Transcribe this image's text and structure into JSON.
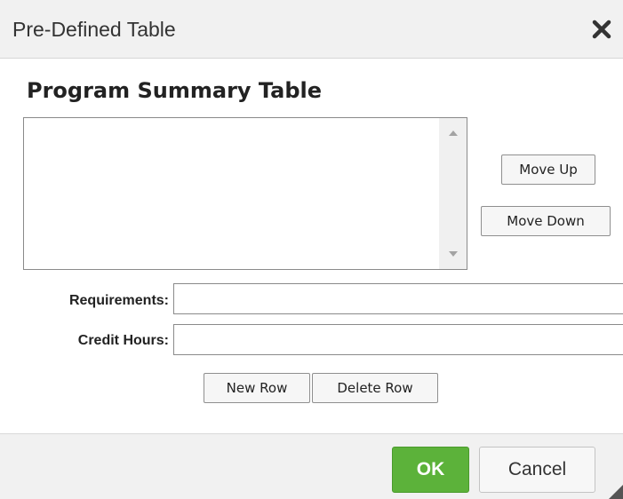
{
  "dialog": {
    "title": "Pre-Defined Table",
    "close_icon": "close-icon"
  },
  "section": {
    "title": "Program Summary Table"
  },
  "listbox": {
    "items": [],
    "scroll_up_icon": "triangle-up-icon",
    "scroll_down_icon": "triangle-down-icon"
  },
  "order_buttons": {
    "move_up": "Move Up",
    "move_down": "Move Down"
  },
  "fields": {
    "requirements": {
      "label": "Requirements:",
      "value": ""
    },
    "credit_hours": {
      "label": "Credit Hours:",
      "value": ""
    }
  },
  "row_buttons": {
    "new_row": "New Row",
    "delete_row": "Delete Row"
  },
  "footer": {
    "ok": "OK",
    "cancel": "Cancel",
    "resize_icon": "resize-grip-icon"
  },
  "colors": {
    "ok_green": "#5cb23a",
    "titlebar_bg": "#f1f1f1",
    "footer_bg": "#f1f1f1"
  }
}
